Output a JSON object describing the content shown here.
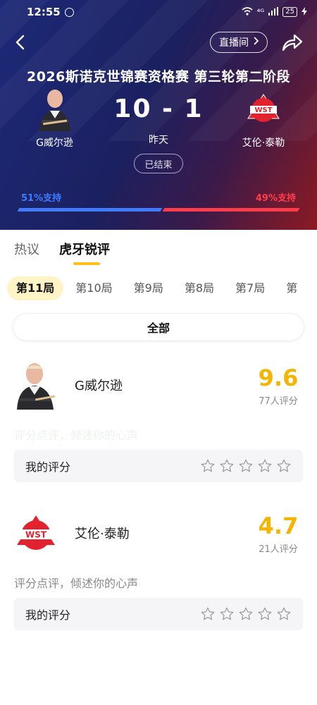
{
  "status_bar": {
    "time": "12:55",
    "signal": "⁴ᴳ",
    "battery": "25"
  },
  "header": {
    "live_label": "直播间",
    "title": "2026斯诺克世锦赛资格赛 第三轮第二阶段"
  },
  "match": {
    "left_player": "G威尔逊",
    "right_player": "艾伦·泰勒",
    "score": "10 - 1",
    "date": "昨天",
    "status": "已结束",
    "left_support": "51%支持",
    "right_support": "49%支持",
    "left_support_fraction": 0.51,
    "colors": {
      "left": "#3f7cff",
      "right": "#ff3c4b"
    }
  },
  "tabs": [
    "热议",
    "虎牙锐评"
  ],
  "active_tab": "虎牙锐评",
  "rounds": [
    "第11局",
    "第10局",
    "第9局",
    "第8局",
    "第7局",
    "第"
  ],
  "active_round": "第11局",
  "filter": {
    "all_label": "全部"
  },
  "players": [
    {
      "name": "G威尔逊",
      "score": "9.6",
      "count": "77人评分",
      "comment": "评分点评，倾述你的心声",
      "my_rating_label": "我的评分",
      "stars_filled": 0
    },
    {
      "name": "艾伦·泰勒",
      "score": "4.7",
      "count": "21人评分",
      "comment": "评分点评，倾述你的心声",
      "my_rating_label": "我的评分",
      "stars_filled": 0
    }
  ],
  "accent": "#f5b400"
}
